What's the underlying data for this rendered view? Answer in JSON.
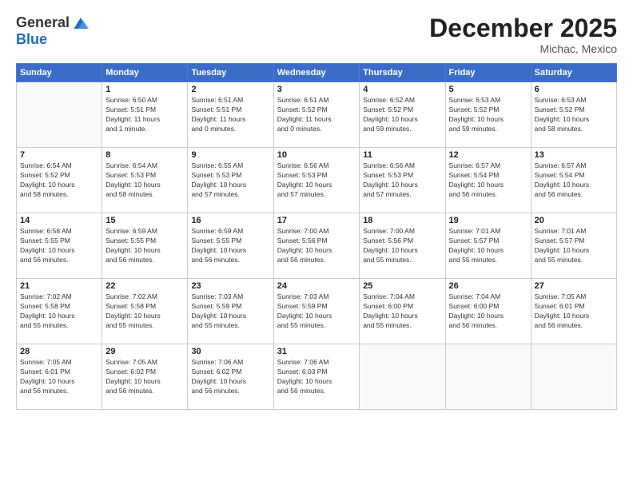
{
  "header": {
    "logo_general": "General",
    "logo_blue": "Blue",
    "month": "December 2025",
    "location": "Michac, Mexico"
  },
  "weekdays": [
    "Sunday",
    "Monday",
    "Tuesday",
    "Wednesday",
    "Thursday",
    "Friday",
    "Saturday"
  ],
  "weeks": [
    [
      {
        "day": "",
        "info": ""
      },
      {
        "day": "1",
        "info": "Sunrise: 6:50 AM\nSunset: 5:51 PM\nDaylight: 11 hours\nand 1 minute."
      },
      {
        "day": "2",
        "info": "Sunrise: 6:51 AM\nSunset: 5:51 PM\nDaylight: 11 hours\nand 0 minutes."
      },
      {
        "day": "3",
        "info": "Sunrise: 6:51 AM\nSunset: 5:52 PM\nDaylight: 11 hours\nand 0 minutes."
      },
      {
        "day": "4",
        "info": "Sunrise: 6:52 AM\nSunset: 5:52 PM\nDaylight: 10 hours\nand 59 minutes."
      },
      {
        "day": "5",
        "info": "Sunrise: 6:53 AM\nSunset: 5:52 PM\nDaylight: 10 hours\nand 59 minutes."
      },
      {
        "day": "6",
        "info": "Sunrise: 6:53 AM\nSunset: 5:52 PM\nDaylight: 10 hours\nand 58 minutes."
      }
    ],
    [
      {
        "day": "7",
        "info": "Sunrise: 6:54 AM\nSunset: 5:52 PM\nDaylight: 10 hours\nand 58 minutes."
      },
      {
        "day": "8",
        "info": "Sunrise: 6:54 AM\nSunset: 5:53 PM\nDaylight: 10 hours\nand 58 minutes."
      },
      {
        "day": "9",
        "info": "Sunrise: 6:55 AM\nSunset: 5:53 PM\nDaylight: 10 hours\nand 57 minutes."
      },
      {
        "day": "10",
        "info": "Sunrise: 6:56 AM\nSunset: 5:53 PM\nDaylight: 10 hours\nand 57 minutes."
      },
      {
        "day": "11",
        "info": "Sunrise: 6:56 AM\nSunset: 5:53 PM\nDaylight: 10 hours\nand 57 minutes."
      },
      {
        "day": "12",
        "info": "Sunrise: 6:57 AM\nSunset: 5:54 PM\nDaylight: 10 hours\nand 56 minutes."
      },
      {
        "day": "13",
        "info": "Sunrise: 6:57 AM\nSunset: 5:54 PM\nDaylight: 10 hours\nand 56 minutes."
      }
    ],
    [
      {
        "day": "14",
        "info": "Sunrise: 6:58 AM\nSunset: 5:55 PM\nDaylight: 10 hours\nand 56 minutes."
      },
      {
        "day": "15",
        "info": "Sunrise: 6:59 AM\nSunset: 5:55 PM\nDaylight: 10 hours\nand 56 minutes."
      },
      {
        "day": "16",
        "info": "Sunrise: 6:59 AM\nSunset: 5:55 PM\nDaylight: 10 hours\nand 56 minutes."
      },
      {
        "day": "17",
        "info": "Sunrise: 7:00 AM\nSunset: 5:56 PM\nDaylight: 10 hours\nand 56 minutes."
      },
      {
        "day": "18",
        "info": "Sunrise: 7:00 AM\nSunset: 5:56 PM\nDaylight: 10 hours\nand 55 minutes."
      },
      {
        "day": "19",
        "info": "Sunrise: 7:01 AM\nSunset: 5:57 PM\nDaylight: 10 hours\nand 55 minutes."
      },
      {
        "day": "20",
        "info": "Sunrise: 7:01 AM\nSunset: 5:57 PM\nDaylight: 10 hours\nand 55 minutes."
      }
    ],
    [
      {
        "day": "21",
        "info": "Sunrise: 7:02 AM\nSunset: 5:58 PM\nDaylight: 10 hours\nand 55 minutes."
      },
      {
        "day": "22",
        "info": "Sunrise: 7:02 AM\nSunset: 5:58 PM\nDaylight: 10 hours\nand 55 minutes."
      },
      {
        "day": "23",
        "info": "Sunrise: 7:03 AM\nSunset: 5:59 PM\nDaylight: 10 hours\nand 55 minutes."
      },
      {
        "day": "24",
        "info": "Sunrise: 7:03 AM\nSunset: 5:59 PM\nDaylight: 10 hours\nand 55 minutes."
      },
      {
        "day": "25",
        "info": "Sunrise: 7:04 AM\nSunset: 6:00 PM\nDaylight: 10 hours\nand 55 minutes."
      },
      {
        "day": "26",
        "info": "Sunrise: 7:04 AM\nSunset: 6:00 PM\nDaylight: 10 hours\nand 56 minutes."
      },
      {
        "day": "27",
        "info": "Sunrise: 7:05 AM\nSunset: 6:01 PM\nDaylight: 10 hours\nand 56 minutes."
      }
    ],
    [
      {
        "day": "28",
        "info": "Sunrise: 7:05 AM\nSunset: 6:01 PM\nDaylight: 10 hours\nand 56 minutes."
      },
      {
        "day": "29",
        "info": "Sunrise: 7:05 AM\nSunset: 6:02 PM\nDaylight: 10 hours\nand 56 minutes."
      },
      {
        "day": "30",
        "info": "Sunrise: 7:06 AM\nSunset: 6:02 PM\nDaylight: 10 hours\nand 56 minutes."
      },
      {
        "day": "31",
        "info": "Sunrise: 7:06 AM\nSunset: 6:03 PM\nDaylight: 10 hours\nand 56 minutes."
      },
      {
        "day": "",
        "info": ""
      },
      {
        "day": "",
        "info": ""
      },
      {
        "day": "",
        "info": ""
      }
    ]
  ]
}
